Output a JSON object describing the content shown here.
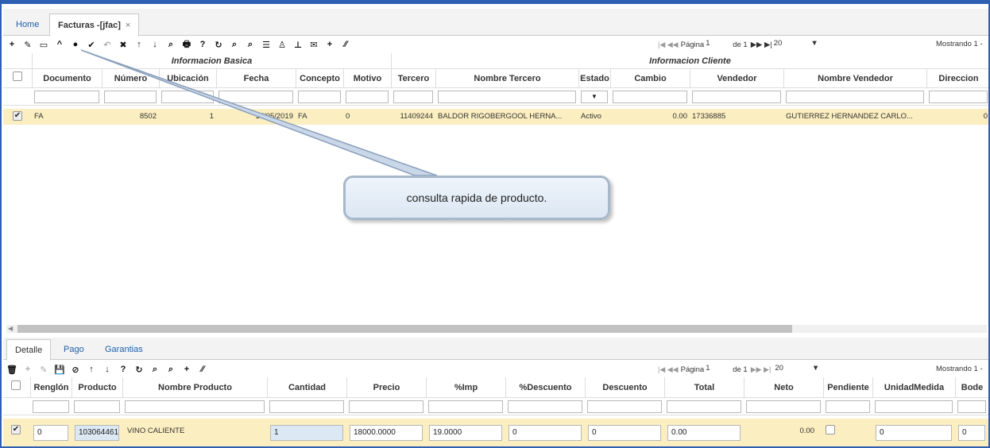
{
  "top_tabs": {
    "home": "Home",
    "active": "Facturas -[jfac]",
    "close": "×"
  },
  "main_toolbar": {
    "buttons": [
      "+",
      "✎",
      "▭",
      "^",
      "●",
      "✔",
      "↶",
      "✖",
      "↑",
      "↓",
      "⌕",
      "🖶",
      "?",
      "↻",
      "⌕",
      "⌕",
      "☰",
      "♙",
      "⊥",
      "✉",
      "+",
      "∕∕"
    ],
    "pager": {
      "first_prev": "|◀ ◀◀",
      "page_label": "Página",
      "page_value": "1",
      "of_label": "de 1",
      "next_last": "▶▶ ▶|",
      "page_size": "20"
    },
    "mostrando": "Mostrando 1 -"
  },
  "main_grid": {
    "groups": {
      "basic": "Informacion Basica",
      "client": "Informacion Cliente"
    },
    "headers": [
      "Documento",
      "Número",
      "Ubicación",
      "Fecha",
      "Concepto",
      "Motivo",
      "Tercero",
      "Nombre Tercero",
      "Estado",
      "Cambio",
      "Vendedor",
      "Nombre Vendedor",
      "Direccion"
    ],
    "estado_filter_icon": "▼",
    "row": {
      "checked": true,
      "documento": "FA",
      "numero": "8502",
      "ubicacion": "1",
      "fecha": "17/05/2019",
      "concepto": "FA",
      "motivo": "0",
      "tercero": "11409244",
      "nombre_tercero": "BALDOR RIGOBERGOOL HERNA...",
      "estado": "Activo",
      "cambio": "0.00",
      "vendedor": "17336885",
      "nombre_vendedor": "GUTIERREZ HERNANDEZ CARLO...",
      "direccion": "0"
    }
  },
  "callout": {
    "text": "consulta rapida de producto."
  },
  "bottom_tabs": [
    "Detalle",
    "Pago",
    "Garantias"
  ],
  "detail_toolbar": {
    "buttons": [
      "🗑",
      "+",
      "✎",
      "💾",
      "⊘",
      "↑",
      "↓",
      "?",
      "↻",
      "⌕",
      "⌕",
      "+",
      "∕∕"
    ],
    "pager": {
      "first_prev": "|◀ ◀◀",
      "page_label": "Página",
      "page_value": "1",
      "of_label": "de 1",
      "next_last": "▶▶ ▶|",
      "page_size": "20"
    },
    "mostrando": "Mostrando 1 -"
  },
  "detail_grid": {
    "headers": [
      "Renglón",
      "Producto",
      "Nombre Producto",
      "Cantidad",
      "Precio",
      "%Imp",
      "%Descuento",
      "Descuento",
      "Total",
      "Neto",
      "Pendiente",
      "UnidadMedida",
      "Bode"
    ],
    "row": {
      "checked": true,
      "renglon": "0",
      "producto": "103064461",
      "nombre_producto": "VINO CALIENTE",
      "cantidad": "1",
      "precio": "18000.0000",
      "imp": "19.0000",
      "descuento_pct": "0",
      "descuento": "0",
      "total": "0.00",
      "neto": "0.00",
      "pendiente": false,
      "unidad_medida": "0",
      "bodega": "0"
    }
  }
}
